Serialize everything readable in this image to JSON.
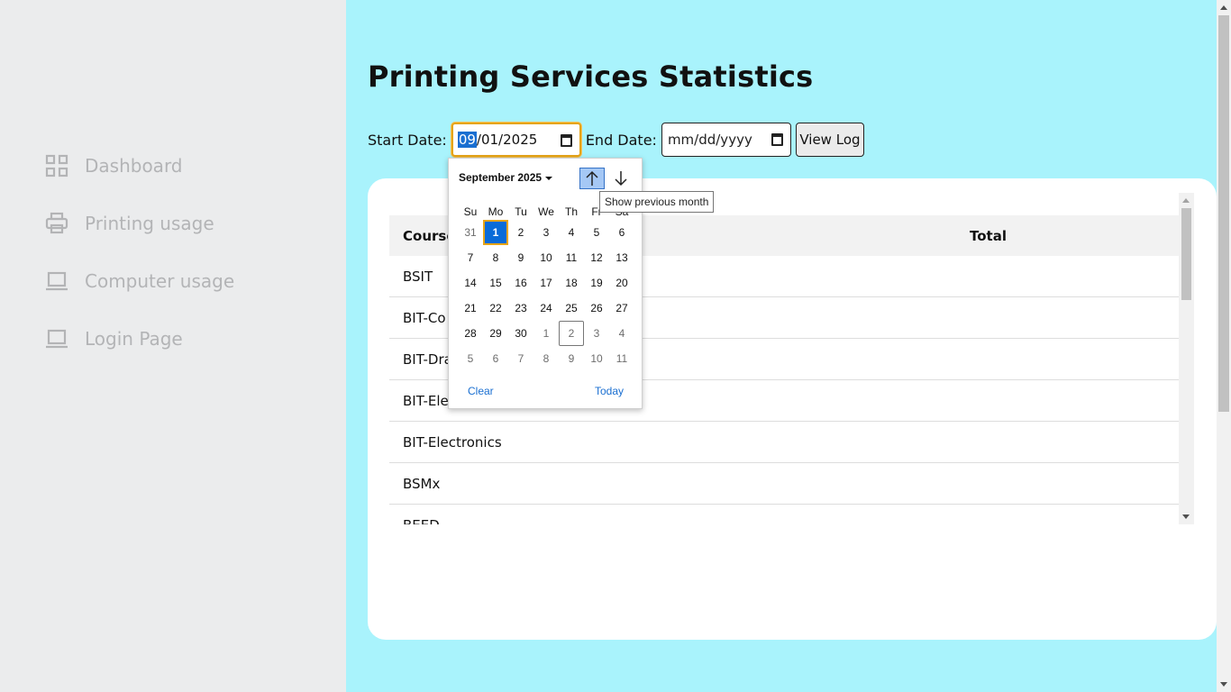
{
  "sidebar": {
    "items": [
      {
        "label": "Dashboard",
        "icon": "grid-icon"
      },
      {
        "label": "Printing usage",
        "icon": "printer-icon"
      },
      {
        "label": "Computer usage",
        "icon": "laptop-icon"
      },
      {
        "label": "Login Page",
        "icon": "laptop-icon"
      }
    ]
  },
  "main": {
    "title": "Printing Services Statistics",
    "start_label": "Start Date:",
    "start_value": {
      "month": "09",
      "rest": "/01/2025"
    },
    "end_label": "End Date:",
    "end_placeholder": "mm/dd/yyyy",
    "view_button": "View Log"
  },
  "table": {
    "headers": [
      "Course",
      "Total"
    ],
    "rows": [
      {
        "course": "BSIT",
        "total": ""
      },
      {
        "course": "BIT-Co",
        "total": ""
      },
      {
        "course": "BIT-Dra",
        "total": ""
      },
      {
        "course": "BIT-Ele",
        "total": ""
      },
      {
        "course": "BIT-Electronics",
        "total": ""
      },
      {
        "course": "BSMx",
        "total": ""
      },
      {
        "course": "BEED",
        "total": ""
      }
    ]
  },
  "calendar": {
    "month_label": "September 2025",
    "weekdays": [
      "Su",
      "Mo",
      "Tu",
      "We",
      "Th",
      "Fr",
      "Sa"
    ],
    "weeks": [
      [
        "31",
        "1",
        "2",
        "3",
        "4",
        "5",
        "6"
      ],
      [
        "7",
        "8",
        "9",
        "10",
        "11",
        "12",
        "13"
      ],
      [
        "14",
        "15",
        "16",
        "17",
        "18",
        "19",
        "20"
      ],
      [
        "21",
        "22",
        "23",
        "24",
        "25",
        "26",
        "27"
      ],
      [
        "28",
        "29",
        "30",
        "1",
        "2",
        "3",
        "4"
      ],
      [
        "5",
        "6",
        "7",
        "8",
        "9",
        "10",
        "11"
      ]
    ],
    "selected": "1",
    "today": "2",
    "clear_label": "Clear",
    "today_label": "Today",
    "tooltip": "Show previous month"
  },
  "colors": {
    "main_bg": "#a9f3fc",
    "sidebar_bg": "#ebeced",
    "accent": "#0a6bd8",
    "focus": "#e6a417"
  }
}
